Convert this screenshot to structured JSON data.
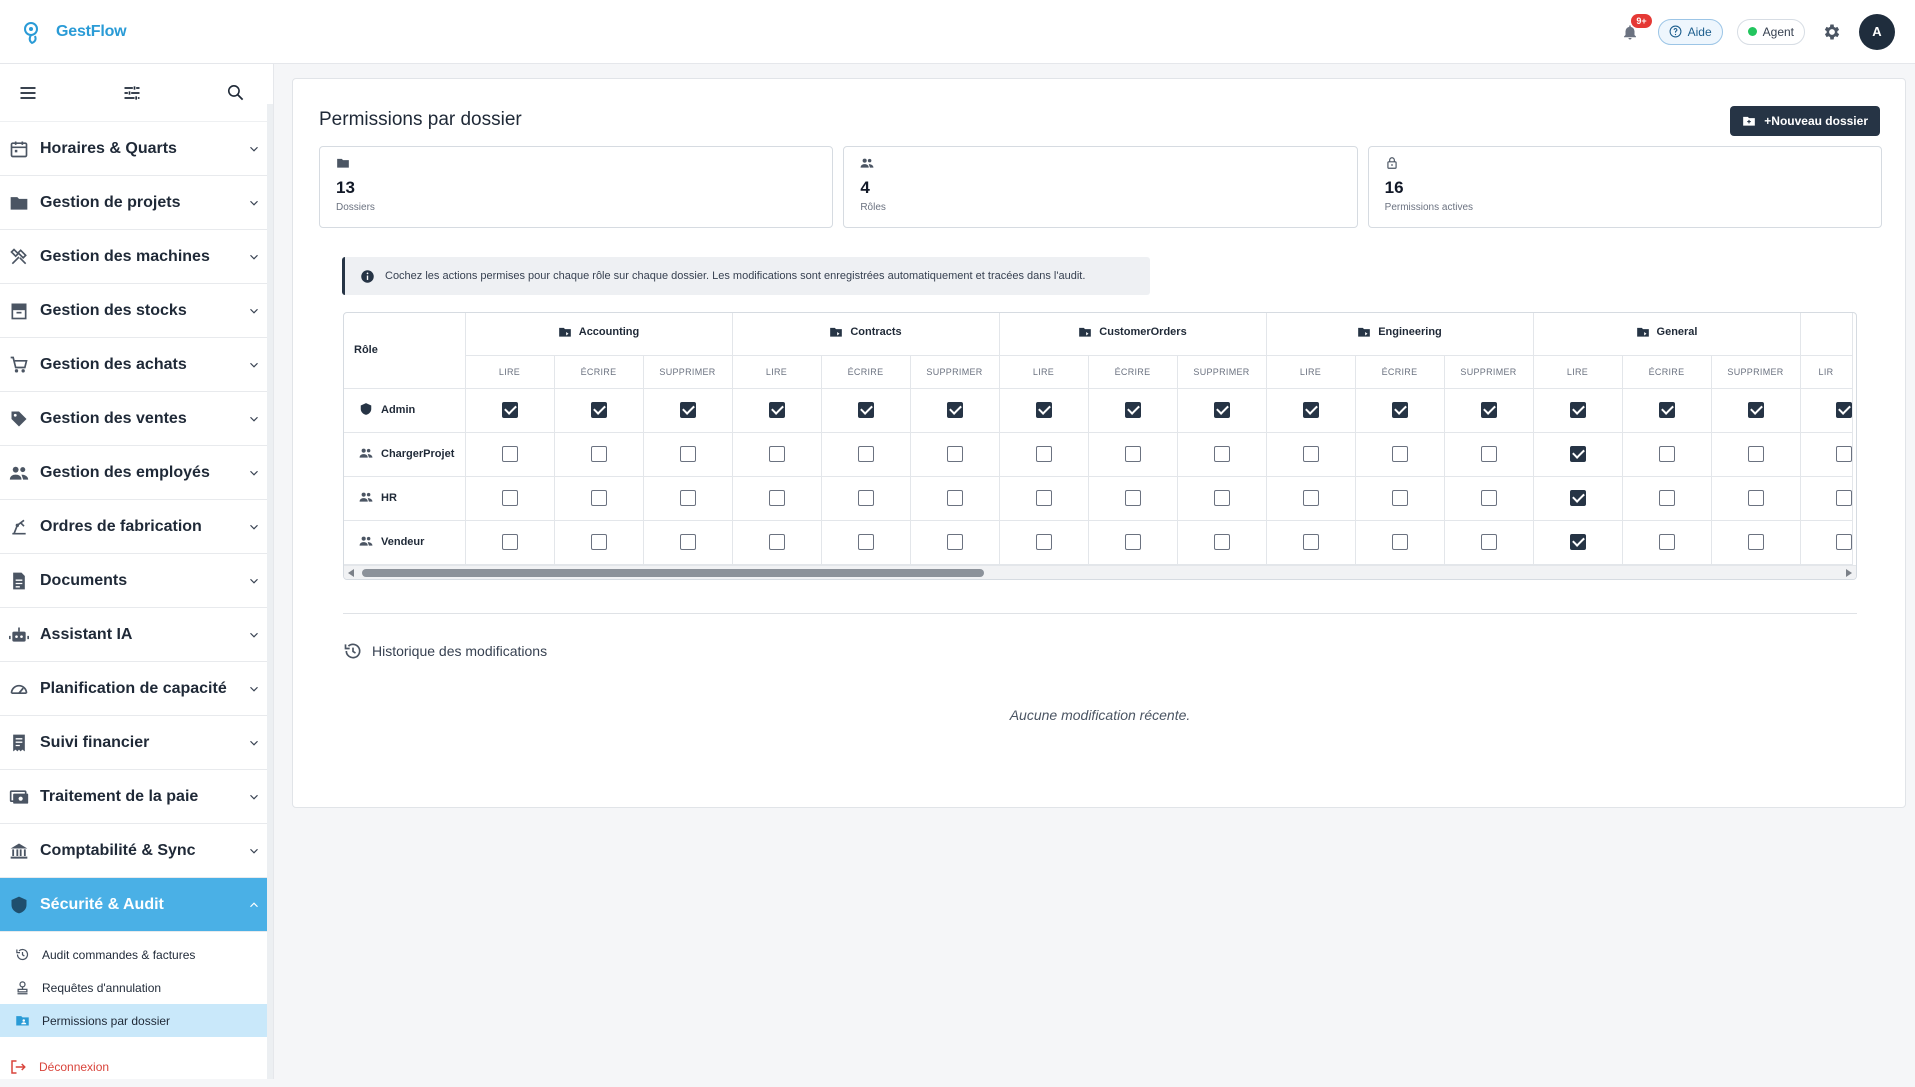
{
  "app": {
    "name": "GestFlow"
  },
  "header": {
    "notif_count": "9+",
    "help_label": "Aide",
    "agent_label": "Agent",
    "avatar_initial": "A"
  },
  "sidebar": {
    "items": [
      {
        "label": "Horaires & Quarts",
        "icon": "calendar-icon"
      },
      {
        "label": "Gestion de projets",
        "icon": "folder-icon"
      },
      {
        "label": "Gestion des machines",
        "icon": "tools-icon"
      },
      {
        "label": "Gestion des stocks",
        "icon": "inventory-icon"
      },
      {
        "label": "Gestion des achats",
        "icon": "cart-icon"
      },
      {
        "label": "Gestion des ventes",
        "icon": "tag-icon"
      },
      {
        "label": "Gestion des employés",
        "icon": "people-icon"
      },
      {
        "label": "Ordres de fabrication",
        "icon": "precision-icon"
      },
      {
        "label": "Documents",
        "icon": "document-icon"
      },
      {
        "label": "Assistant IA",
        "icon": "robot-icon"
      },
      {
        "label": "Planification de capacité",
        "icon": "gauge-icon"
      },
      {
        "label": "Suivi financier",
        "icon": "receipt-icon"
      },
      {
        "label": "Traitement de la paie",
        "icon": "payroll-icon"
      },
      {
        "label": "Comptabilité & Sync",
        "icon": "bank-icon"
      },
      {
        "label": "Sécurité & Audit",
        "icon": "shield-icon",
        "active": true
      }
    ],
    "sub_items": [
      {
        "label": "Audit commandes & factures",
        "icon": "history-icon"
      },
      {
        "label": "Requêtes d'annulation",
        "icon": "stamp-icon"
      },
      {
        "label": "Permissions par dossier",
        "icon": "folder-shared-icon",
        "active": true
      }
    ],
    "logout_label": "Déconnexion"
  },
  "main": {
    "title": "Permissions par dossier",
    "new_button_label": "+Nouveau dossier",
    "stats": [
      {
        "value": "13",
        "caption": "Dossiers",
        "icon": "folder-icon"
      },
      {
        "value": "4",
        "caption": "Rôles",
        "icon": "people-icon"
      },
      {
        "value": "16",
        "caption": "Permissions actives",
        "icon": "lock-icon"
      }
    ],
    "info_text": "Cochez les actions permises pour chaque rôle sur chaque dossier. Les modifications sont enregistrées automatiquement et tracées dans l'audit.",
    "table": {
      "role_header": "Rôle",
      "folders": [
        "Accounting",
        "Contracts",
        "CustomerOrders",
        "Engineering",
        "General"
      ],
      "partial_perm_label": "LIR",
      "perms": [
        "LIRE",
        "ÉCRIRE",
        "SUPPRIMER"
      ],
      "roles": [
        {
          "name": "Admin",
          "icon": "shield-icon",
          "checks": [
            true,
            true,
            true,
            true,
            true,
            true,
            true,
            true,
            true,
            true,
            true,
            true,
            true,
            true,
            true,
            true
          ]
        },
        {
          "name": "ChargerProjet",
          "icon": "people-icon",
          "checks": [
            false,
            false,
            false,
            false,
            false,
            false,
            false,
            false,
            false,
            false,
            false,
            false,
            true,
            false,
            false,
            false
          ]
        },
        {
          "name": "HR",
          "icon": "people-icon",
          "checks": [
            false,
            false,
            false,
            false,
            false,
            false,
            false,
            false,
            false,
            false,
            false,
            false,
            true,
            false,
            false,
            false
          ]
        },
        {
          "name": "Vendeur",
          "icon": "people-icon",
          "checks": [
            false,
            false,
            false,
            false,
            false,
            false,
            false,
            false,
            false,
            false,
            false,
            false,
            true,
            false,
            false,
            false
          ]
        }
      ]
    },
    "history_title": "Historique des modifications",
    "history_empty": "Aucune modification récente."
  },
  "colors": {
    "brand": "#2a9bd6",
    "active_nav": "#4ab0e6",
    "active_sub": "#c9e8fa",
    "dark": "#263445",
    "danger": "#d9443b"
  }
}
